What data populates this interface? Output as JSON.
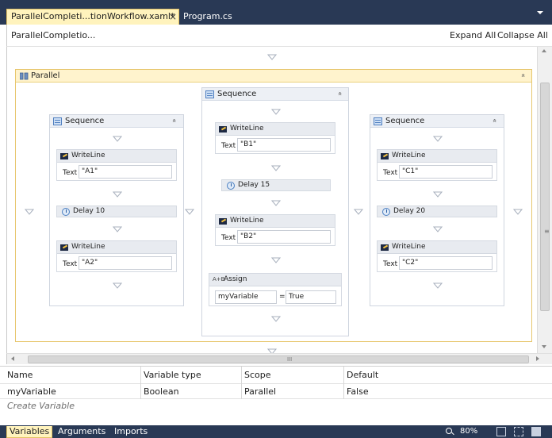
{
  "tabs": {
    "active_label": "ParallelCompleti...tionWorkflow.xaml*",
    "close_glyph": "×",
    "inactive_label": "Program.cs"
  },
  "breadcrumb": {
    "path": "ParallelCompletio...",
    "expand_all": "Expand All",
    "collapse_all": "Collapse All"
  },
  "designer": {
    "parallel": {
      "title": "Parallel",
      "collapse_glyph": "«"
    },
    "sequence_left": {
      "title": "Sequence",
      "writeline1": {
        "title": "WriteLine",
        "label": "Text",
        "value": "\"A1\""
      },
      "delay": {
        "title": "Delay 10"
      },
      "writeline2": {
        "title": "WriteLine",
        "label": "Text",
        "value": "\"A2\""
      }
    },
    "sequence_middle": {
      "title": "Sequence",
      "writeline1": {
        "title": "WriteLine",
        "label": "Text",
        "value": "\"B1\""
      },
      "delay": {
        "title": "Delay 15"
      },
      "writeline2": {
        "title": "WriteLine",
        "label": "Text",
        "value": "\"B2\""
      },
      "assign": {
        "icon_text": "A+B",
        "title": "Assign",
        "to": "myVariable",
        "operator": "=",
        "value": "True"
      }
    },
    "sequence_right": {
      "title": "Sequence",
      "writeline1": {
        "title": "WriteLine",
        "label": "Text",
        "value": "\"C1\""
      },
      "delay": {
        "title": "Delay 20"
      },
      "writeline2": {
        "title": "WriteLine",
        "label": "Text",
        "value": "\"C2\""
      }
    },
    "hscroll_grip": "III",
    "vscroll_grip": "≡"
  },
  "variables": {
    "headers": [
      "Name",
      "Variable type",
      "Scope",
      "Default"
    ],
    "rows": [
      [
        "myVariable",
        "Boolean",
        "Parallel",
        "False"
      ]
    ],
    "create_placeholder": "Create Variable"
  },
  "statusbar": {
    "tabs": [
      "Variables",
      "Arguments",
      "Imports"
    ],
    "zoom": "80%"
  },
  "colors": {
    "chrome": "#293955",
    "active_tab": "#fff3bd",
    "parallel_border": "#e7c66d"
  }
}
